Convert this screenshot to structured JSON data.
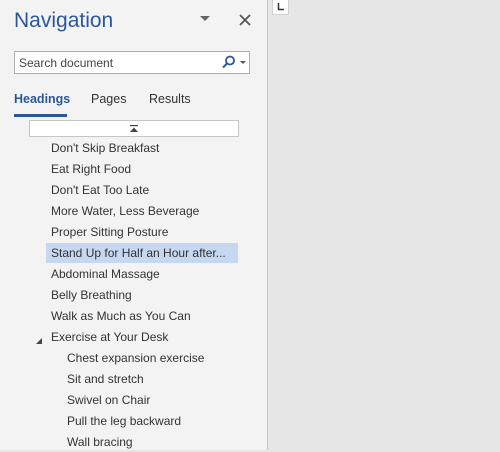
{
  "pane": {
    "title": "Navigation",
    "menu_icon": "chevron-down-icon",
    "close_icon": "close-icon"
  },
  "search": {
    "placeholder": "Search document",
    "value": "",
    "icon": "search-icon"
  },
  "tabs": [
    {
      "label": "Headings",
      "active": true
    },
    {
      "label": "Pages",
      "active": false
    },
    {
      "label": "Results",
      "active": false
    }
  ],
  "collapse_all_icon": "collapse-to-top-icon",
  "headings": [
    {
      "label": "Don't Skip Breakfast",
      "level": 1
    },
    {
      "label": "Eat Right Food",
      "level": 1
    },
    {
      "label": "Don't Eat Too Late",
      "level": 1
    },
    {
      "label": "More Water, Less Beverage",
      "level": 1
    },
    {
      "label": "Proper Sitting Posture",
      "level": 1
    },
    {
      "label": "Stand Up for Half an Hour after...",
      "level": 1,
      "selected": true
    },
    {
      "label": "Abdominal Massage",
      "level": 1
    },
    {
      "label": "Belly Breathing",
      "level": 1
    },
    {
      "label": "Walk as Much as You Can",
      "level": 1
    },
    {
      "label": "Exercise at Your Desk",
      "level": 1,
      "expanded": true
    },
    {
      "label": "Chest expansion exercise",
      "level": 2
    },
    {
      "label": "Sit and stretch",
      "level": 2
    },
    {
      "label": "Swivel on Chair",
      "level": 2
    },
    {
      "label": "Pull the leg backward",
      "level": 2
    },
    {
      "label": "Wall bracing",
      "level": 2
    }
  ],
  "colors": {
    "accent": "#2b579a",
    "selection": "#c5d7f1",
    "pane_bg": "#f3f3f3",
    "doc_bg": "#e6e6e6"
  },
  "ruler": {
    "tab_selector_icon": "left-tab-stop-icon"
  }
}
